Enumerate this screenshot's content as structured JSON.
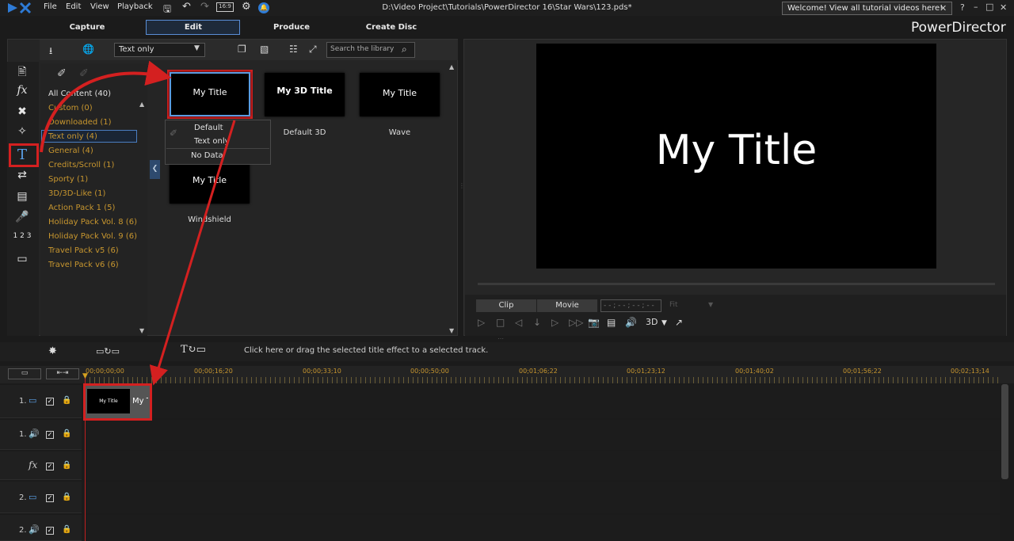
{
  "titlebar": {
    "menu": [
      "File",
      "Edit",
      "View",
      "Playback"
    ],
    "file_path": "D:\\Video Project\\Tutorials\\PowerDirector 16\\Star Wars\\123.pds*",
    "welcome_text": "Welcome! View all tutorial videos here!",
    "welcome_close": "✕",
    "window_controls": [
      "?",
      "–",
      "□",
      "✕"
    ]
  },
  "mode_tabs": [
    "Capture",
    "Edit",
    "Produce",
    "Create Disc"
  ],
  "brand": "PowerDirector",
  "library": {
    "filter_value": "Text only",
    "search_placeholder": "Search the library",
    "categories": [
      "All Content (40)",
      "Custom  (0)",
      "Downloaded  (1)",
      "Text only  (4)",
      "General  (4)",
      "Credits/Scroll  (1)",
      "Sporty  (1)",
      "3D/3D-Like  (1)",
      "Action Pack 1  (5)",
      "Holiday Pack Vol. 8  (6)",
      "Holiday Pack Vol. 9  (6)",
      "Travel Pack v5  (6)",
      "Travel Pack v6  (6)"
    ],
    "templates": [
      {
        "thumb": "My Title",
        "caption": ""
      },
      {
        "thumb": "My 3D Title",
        "caption": "Default 3D"
      },
      {
        "thumb": "My Title",
        "caption": "Wave"
      },
      {
        "thumb": "My Title",
        "caption": "Windshield"
      }
    ],
    "dropdown": [
      "Default",
      "Text only",
      "No Data"
    ]
  },
  "preview": {
    "title_text": "My Title",
    "clip_label": "Clip",
    "movie_label": "Movie",
    "timecode": "- - ; - - ; - - ; - -",
    "fit_label": "Fit",
    "mode_3d": "3D"
  },
  "timeline": {
    "hint": "Click here or drag the selected title effect to a selected track.",
    "ruler": [
      "00;00;00;00",
      "00;00;16;20",
      "00;00;33;10",
      "00;00;50;00",
      "00;01;06;22",
      "00;01;23;12",
      "00;01;40;02",
      "00;01;56;22",
      "00;02;13;14"
    ],
    "tracks": [
      "1.",
      "1.",
      "fx",
      "2.",
      "2."
    ],
    "clip_thumb": "My Title",
    "clip_label": "My T"
  },
  "colors": {
    "accent_blue": "#5a9be0",
    "highlight_red": "#d42020",
    "category_gold": "#c7962f"
  }
}
